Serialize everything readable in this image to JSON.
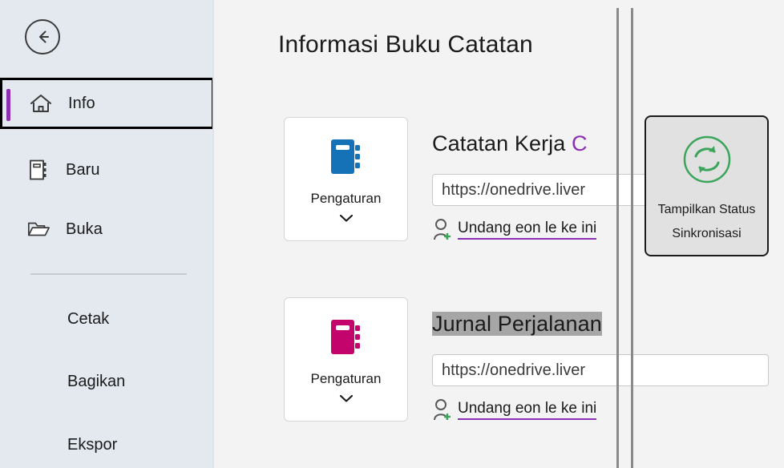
{
  "sidebar": {
    "back_button": {
      "icon": "back-arrow-icon"
    },
    "nav_items": [
      {
        "label": "Info",
        "icon": "home-icon",
        "selected": true
      },
      {
        "label": "Baru",
        "icon": "new-notebook-icon",
        "selected": false
      },
      {
        "label": "Buka",
        "icon": "open-folder-icon",
        "selected": false
      }
    ],
    "text_items": [
      {
        "label": "Cetak"
      },
      {
        "label": "Bagikan"
      },
      {
        "label": "Ekspor"
      }
    ],
    "accent_color": "#8b2fb5",
    "background_color": "#e3e9ef"
  },
  "main": {
    "title": "Informasi Buku Catatan",
    "notebooks": [
      {
        "settings_label": "Pengaturan",
        "settings_icon": "notebook-icon",
        "icon_color": "#1572b6",
        "title": "Catatan Kerja",
        "title_suffix": "C",
        "title_highlighted": false,
        "url": "https://onedrive.liver",
        "invite_label": "Undang eon le ke ini",
        "invite_icon": "person-add-icon"
      },
      {
        "settings_label": "Pengaturan",
        "settings_icon": "notebook-icon",
        "icon_color": "#c2046c",
        "title": "Jurnal Perjalanan",
        "title_suffix": "",
        "title_highlighted": true,
        "url": "https://onedrive.liver",
        "invite_label": "Undang eon le ke ini",
        "invite_icon": "person-add-icon"
      }
    ],
    "sync_button": {
      "line1": "Tampilkan Status",
      "line2": "Sinkronisasi",
      "icon": "sync-refresh-icon",
      "icon_color": "#3ba55c"
    }
  }
}
